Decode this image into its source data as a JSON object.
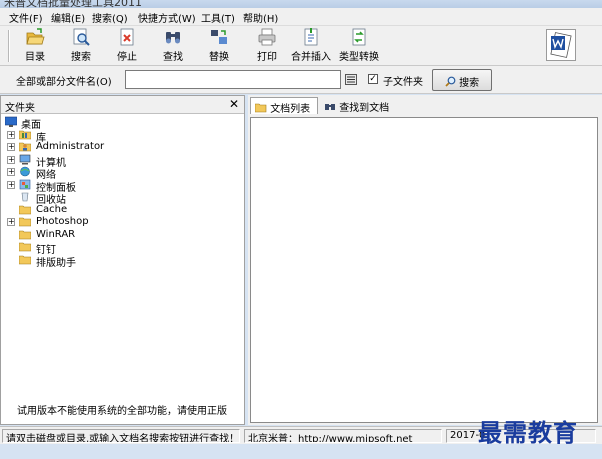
{
  "window": {
    "title": "米普文档批量处理工具2011"
  },
  "menu": {
    "items": [
      "文件(F)",
      "编辑(E)",
      "搜索(Q)",
      "快捷方式(W)",
      "工具(T)",
      "帮助(H)"
    ]
  },
  "toolbar": {
    "buttons": [
      {
        "label": "目录",
        "icon": "folder-open-icon"
      },
      {
        "label": "搜索",
        "icon": "search-icon"
      },
      {
        "label": "停止",
        "icon": "stop-icon"
      },
      {
        "label": "查找",
        "icon": "binoculars-icon"
      },
      {
        "label": "替换",
        "icon": "replace-icon"
      },
      {
        "label": "打印",
        "icon": "printer-icon"
      },
      {
        "label": "合并插入",
        "icon": "merge-insert-icon"
      },
      {
        "label": "类型转换",
        "icon": "type-convert-icon"
      }
    ]
  },
  "searchbar": {
    "label": "全部或部分文件名(O)",
    "input_value": "",
    "subfolder_label": "子文件夹",
    "subfolder_checked": true,
    "search_button": "搜索"
  },
  "folder_panel": {
    "title": "文件夹",
    "close": "✕",
    "tree": [
      {
        "label": "桌面",
        "level": 0,
        "expander": "",
        "icon": "desktop-icon"
      },
      {
        "label": "库",
        "level": 1,
        "expander": "+",
        "icon": "library-icon"
      },
      {
        "label": "Administrator",
        "level": 1,
        "expander": "+",
        "icon": "user-folder-icon"
      },
      {
        "label": "计算机",
        "level": 1,
        "expander": "+",
        "icon": "computer-icon"
      },
      {
        "label": "网络",
        "level": 1,
        "expander": "+",
        "icon": "network-icon"
      },
      {
        "label": "控制面板",
        "level": 1,
        "expander": "+",
        "icon": "control-panel-icon"
      },
      {
        "label": "回收站",
        "level": 1,
        "expander": "",
        "icon": "recycle-bin-icon"
      },
      {
        "label": "Cache",
        "level": 1,
        "expander": "",
        "icon": "folder-icon"
      },
      {
        "label": "Photoshop",
        "level": 1,
        "expander": "+",
        "icon": "folder-icon"
      },
      {
        "label": "WinRAR",
        "level": 1,
        "expander": "",
        "icon": "folder-icon"
      },
      {
        "label": "钉钉",
        "level": 1,
        "expander": "",
        "icon": "folder-icon"
      },
      {
        "label": "排版助手",
        "level": 1,
        "expander": "",
        "icon": "folder-icon"
      }
    ],
    "trial_notice": "试用版本不能使用系统的全部功能，请使用正版"
  },
  "result_panel": {
    "tabs": [
      {
        "label": "文档列表",
        "icon": "folder-open-icon",
        "active": true
      },
      {
        "label": "查找到文档",
        "icon": "binoculars-icon",
        "active": false
      }
    ]
  },
  "status": {
    "hint": "请双击磁盘或目录,或输入文档名搜索按钮进行查找！",
    "vendor": "北京米普：http://www.mipsoft.net",
    "date": "2017-0"
  },
  "watermark": {
    "text": "最需教育"
  },
  "colors": {
    "folder": "#f2c85a",
    "accent": "#1a3c9e",
    "stop_red": "#d93a2a"
  }
}
